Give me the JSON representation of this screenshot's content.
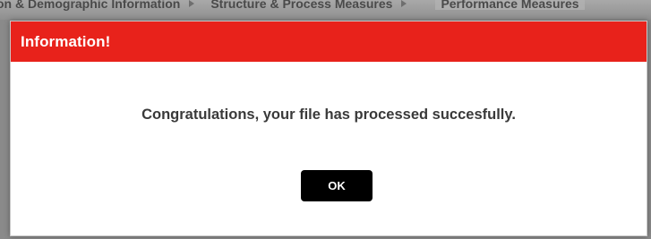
{
  "background_tabs": [
    {
      "label": "on & Demographic Information"
    },
    {
      "label": "Structure & Process Measures"
    },
    {
      "label": "Performance Measures"
    }
  ],
  "dialog": {
    "title": "Information!",
    "message": "Congratulations, your file has processed succesfully.",
    "ok_label": "OK"
  },
  "colors": {
    "header": "#e8221b",
    "button": "#000000",
    "backdrop": "#8a8a8a"
  }
}
